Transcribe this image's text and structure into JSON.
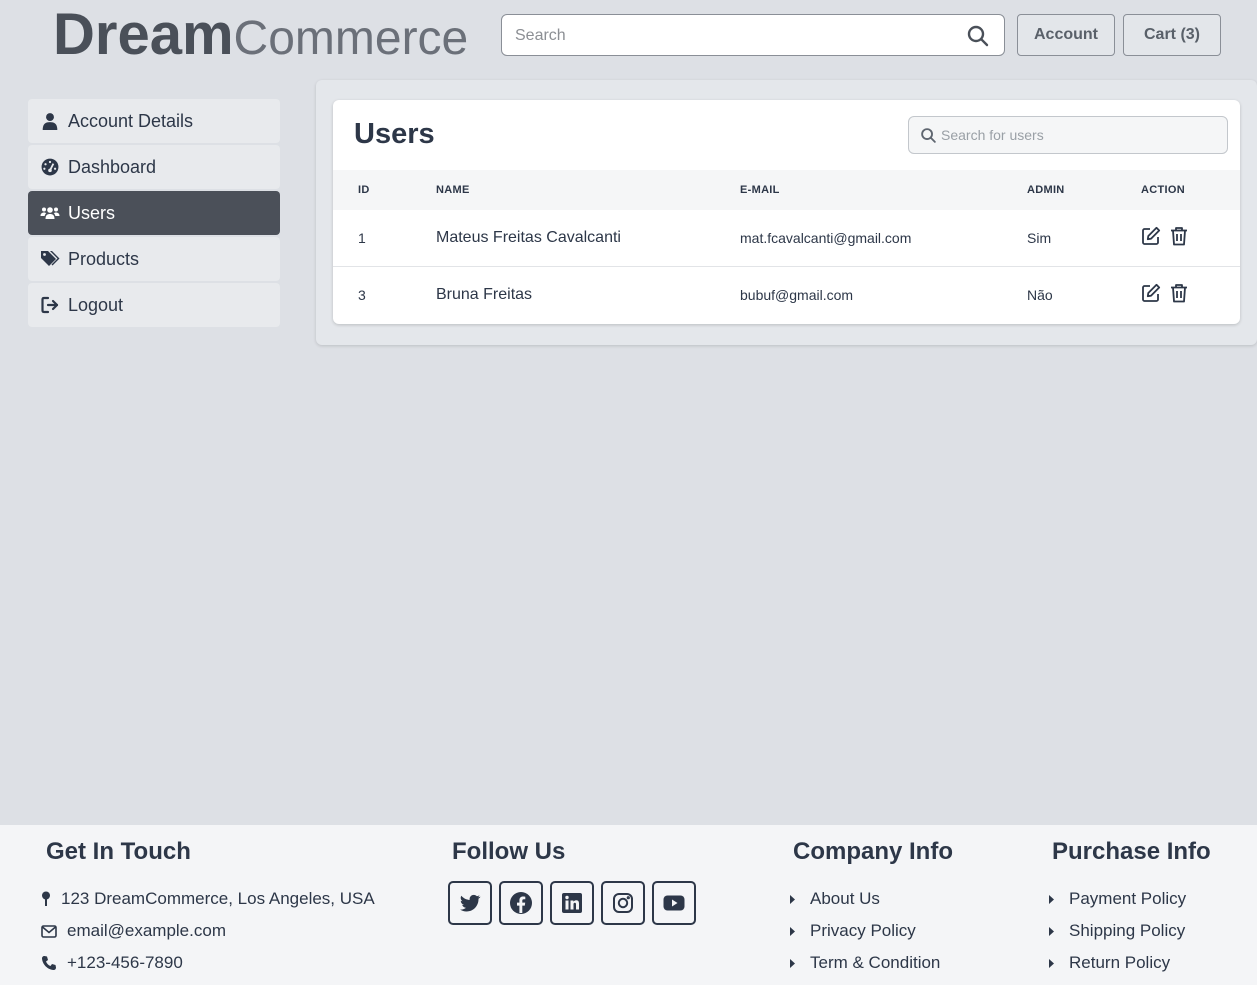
{
  "header": {
    "logo_bold": "Dream",
    "logo_light": "Commerce",
    "search_placeholder": "Search",
    "account_label": "Account",
    "cart_label": "Cart (3)"
  },
  "sidebar": {
    "items": [
      {
        "label": "Account Details",
        "icon": "user-icon"
      },
      {
        "label": "Dashboard",
        "icon": "dashboard-icon"
      },
      {
        "label": "Users",
        "icon": "users-icon",
        "active": true
      },
      {
        "label": "Products",
        "icon": "tags-icon"
      },
      {
        "label": "Logout",
        "icon": "logout-icon"
      }
    ]
  },
  "users_panel": {
    "title": "Users",
    "search_placeholder": "Search for users",
    "columns": [
      "ID",
      "NAME",
      "E-MAIL",
      "ADMIN",
      "ACTION"
    ],
    "rows": [
      {
        "id": "1",
        "name": "Mateus Freitas Cavalcanti",
        "email": "mat.fcavalcanti@gmail.com",
        "admin": "Sim"
      },
      {
        "id": "3",
        "name": "Bruna Freitas",
        "email": "bubuf@gmail.com",
        "admin": "Não"
      }
    ]
  },
  "footer": {
    "contact": {
      "title": "Get In Touch",
      "address": "123 DreamCommerce, Los Angeles, USA",
      "email": "email@example.com",
      "phone": "+123-456-7890"
    },
    "follow": {
      "title": "Follow Us",
      "icons": [
        "twitter-icon",
        "facebook-icon",
        "linkedin-icon",
        "instagram-icon",
        "youtube-icon"
      ]
    },
    "company": {
      "title": "Company Info",
      "links": [
        "About Us",
        "Privacy Policy",
        "Term & Condition"
      ]
    },
    "purchase": {
      "title": "Purchase Info",
      "links": [
        "Payment Policy",
        "Shipping Policy",
        "Return Policy"
      ]
    }
  },
  "colors": {
    "background": "#dde0e5",
    "active_sidebar": "#4b5059",
    "text": "#2d3748"
  }
}
